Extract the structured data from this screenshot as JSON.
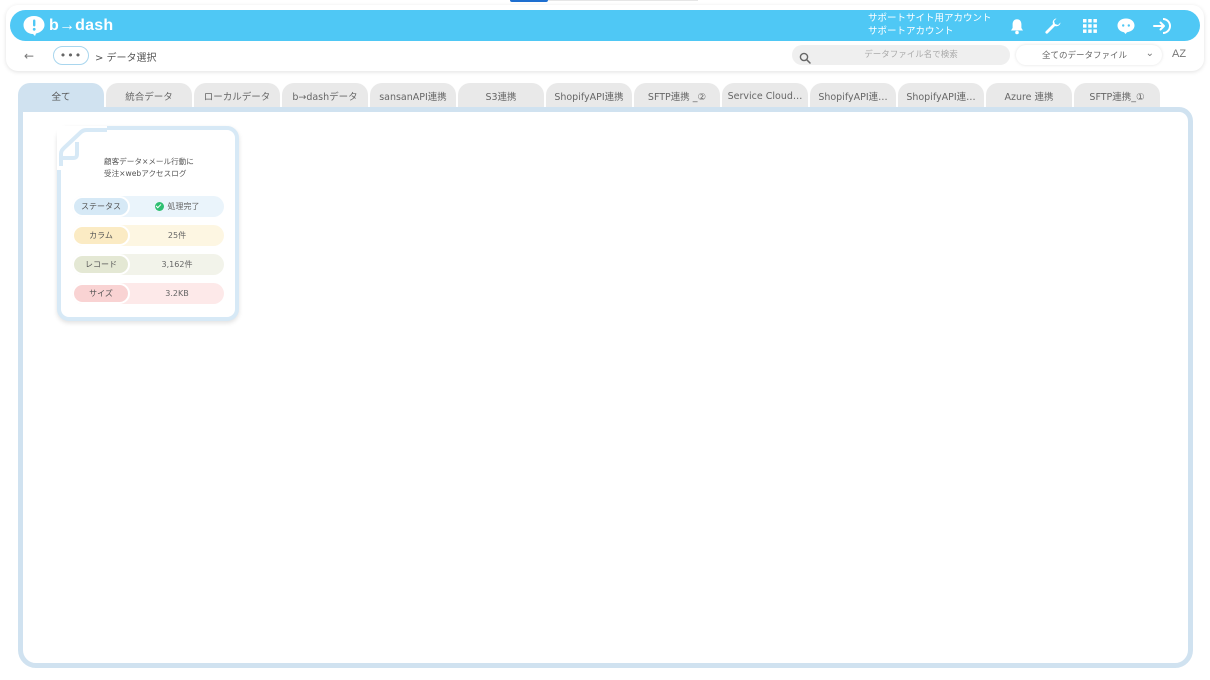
{
  "app": {
    "logo_text": "b→dash"
  },
  "header": {
    "account_line1": "サポートサイト用アカウント",
    "account_line2": "サポートアカウント",
    "icons": [
      "bell-icon",
      "wrench-icon",
      "grid-icon",
      "chat-icon",
      "logout-icon"
    ],
    "accent_color": "#4fc8f5"
  },
  "toolbar": {
    "dots_label": "•••",
    "breadcrumb": "> データ選択",
    "search_placeholder": "データファイル名で検索",
    "filter_value": "全てのデータファイル",
    "sort_label": "AZ"
  },
  "tabs": [
    {
      "label": "全て",
      "active": true
    },
    {
      "label": "統合データ"
    },
    {
      "label": "ローカルデータ"
    },
    {
      "label": "b→dashデータ"
    },
    {
      "label": "sansanAPI連携"
    },
    {
      "label": "S3連携"
    },
    {
      "label": "ShopifyAPI連携"
    },
    {
      "label": "SFTP連携 _②"
    },
    {
      "label": "Service Cloud…"
    },
    {
      "label": "ShopifyAPI連…"
    },
    {
      "label": "ShopifyAPI連…"
    },
    {
      "label": "Azure 連携"
    },
    {
      "label": "SFTP連携_①"
    }
  ],
  "cards": [
    {
      "title_line1": "顧客データ×メール行動に",
      "title_line2": "受注×webアクセスログ",
      "status_label": "ステータス",
      "status_value": "処理完了",
      "column_label": "カラム",
      "column_value": "25件",
      "record_label": "レコード",
      "record_value": "3,162件",
      "size_label": "サイズ",
      "size_value": "3.2KB"
    }
  ]
}
